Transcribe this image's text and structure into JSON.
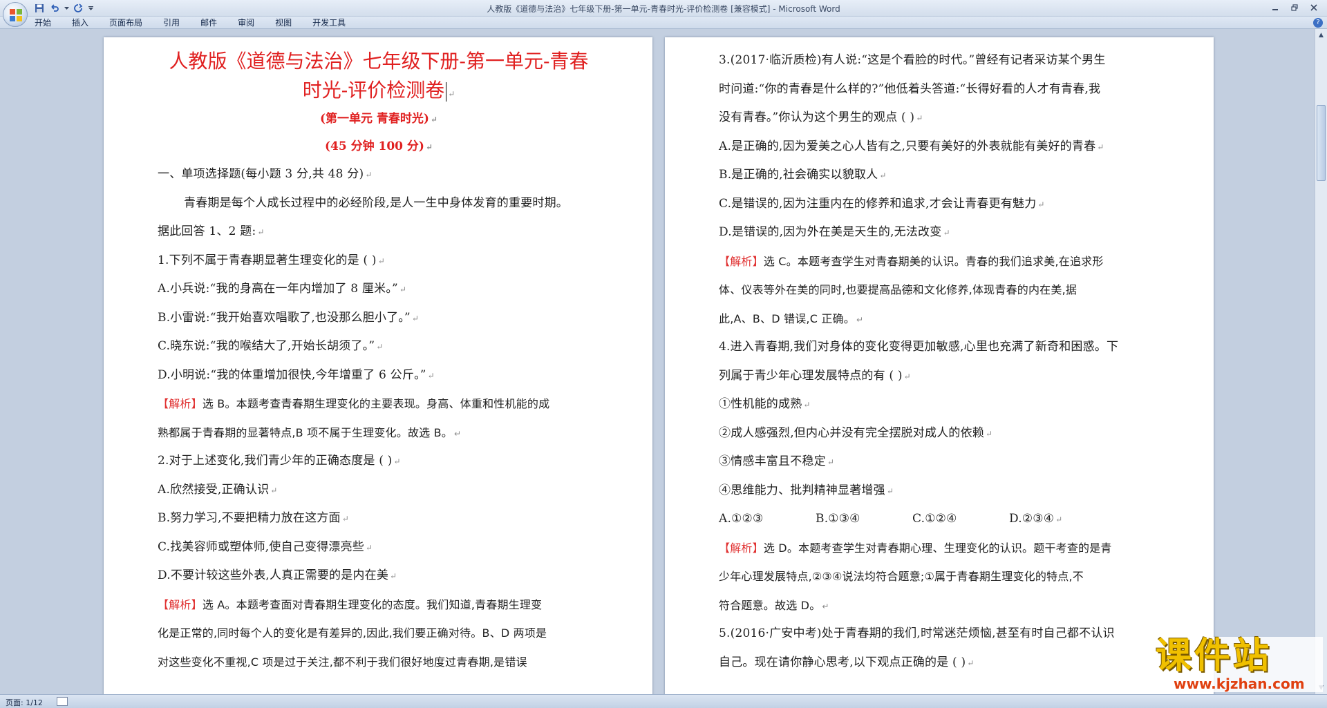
{
  "window": {
    "title": "人教版《道德与法治》七年级下册-第一单元-青春时光-评价检测卷 [兼容模式] - Microsoft Word"
  },
  "menu": {
    "items": [
      "开始",
      "插入",
      "页面布局",
      "引用",
      "邮件",
      "审阅",
      "视图",
      "开发工具"
    ]
  },
  "status": {
    "page_count": "页面: 1/12"
  },
  "watermark": {
    "text": "课件站",
    "url": "www.kjzhan.com"
  },
  "doc": {
    "title_line1": "人教版《道德与法治》七年级下册-第一单元-青春",
    "title_line2": "时光-评价检测卷",
    "subtitle": "(第一单元  青春时光)",
    "time_score": "(45 分钟    100 分)",
    "section1": "一、单项选择题(每小题 3 分,共 48 分)",
    "intro_a": "青春期是每个人成长过程中的必经阶段,是人一生中身体发育的重要时期。",
    "intro_b": "据此回答 1、2 题:",
    "q1": "1.下列不属于青春期显著生理变化的是  (      )",
    "q1_a": "A.小兵说:“我的身高在一年内增加了 8 厘米。”",
    "q1_b": "B.小雷说:“我开始喜欢唱歌了,也没那么胆小了。”",
    "q1_c": "C.晓东说:“我的喉结大了,开始长胡须了。”",
    "q1_d": "D.小明说:“我的体重增加很快,今年增重了 6 公斤。”",
    "jiexi_label": "【解析】",
    "q1_exp1": "选 B。本题考查青春期生理变化的主要表现。身高、体重和性机能的成",
    "q1_exp2": "熟都属于青春期的显著特点,B 项不属于生理变化。故选 B。",
    "q2": "2.对于上述变化,我们青少年的正确态度是  (      )",
    "q2_a": "A.欣然接受,正确认识",
    "q2_b": "B.努力学习,不要把精力放在这方面",
    "q2_c": "C.找美容师或塑体师,使自己变得漂亮些",
    "q2_d": "D.不要计较这些外表,人真正需要的是内在美",
    "q2_exp1": "选 A。本题考查面对青春期生理变化的态度。我们知道,青春期生理变",
    "q2_exp2": "化是正常的,同时每个人的变化是有差异的,因此,我们要正确对待。B、D 两项是",
    "q2_exp3": "对这些变化不重视,C 项是过于关注,都不利于我们很好地度过青春期,是错误",
    "q3_1": "3.(2017·临沂质检)有人说:“这是个看脸的时代。”曾经有记者采访某个男生",
    "q3_2": "时问道:“你的青春是什么样的?”他低着头答道:“长得好看的人才有青春,我",
    "q3_3": "没有青春。”你认为这个男生的观点  (      )",
    "q3_a": "A.是正确的,因为爱美之心人皆有之,只要有美好的外表就能有美好的青春",
    "q3_b": "B.是正确的,社会确实以貌取人",
    "q3_c": "C.是错误的,因为注重内在的修养和追求,才会让青春更有魅力",
    "q3_d": "D.是错误的,因为外在美是天生的,无法改变",
    "q3_exp1": "选 C。本题考查学生对青春期美的认识。青春的我们追求美,在追求形",
    "q3_exp2": "体、仪表等外在美的同时,也要提高品德和文化修养,体现青春的内在美,据",
    "q3_exp3": "此,A、B、D 错误,C 正确。",
    "q4_1": "4.进入青春期,我们对身体的变化变得更加敏感,心里也充满了新奇和困惑。下",
    "q4_2": "列属于青少年心理发展特点的有  (      )",
    "q4_s1": "①性机能的成熟",
    "q4_s2": "②成人感强烈,但内心并没有完全摆脱对成人的依赖",
    "q4_s3": "③情感丰富且不稳定",
    "q4_s4": "④思维能力、批判精神显著增强",
    "q4_opts": [
      "A.①②③",
      "B.①③④",
      "C.①②④",
      "D.②③④"
    ],
    "q4_exp1": "选 D。本题考查学生对青春期心理、生理变化的认识。题干考查的是青",
    "q4_exp2": "少年心理发展特点,②③④说法均符合题意;①属于青春期生理变化的特点,不",
    "q4_exp3": "符合题意。故选 D。",
    "q5_1": "5.(2016·广安中考)处于青春期的我们,时常迷茫烦恼,甚至有时自己都不认识",
    "q5_2": "自己。现在请你静心思考,以下观点正确的是  (      )"
  }
}
